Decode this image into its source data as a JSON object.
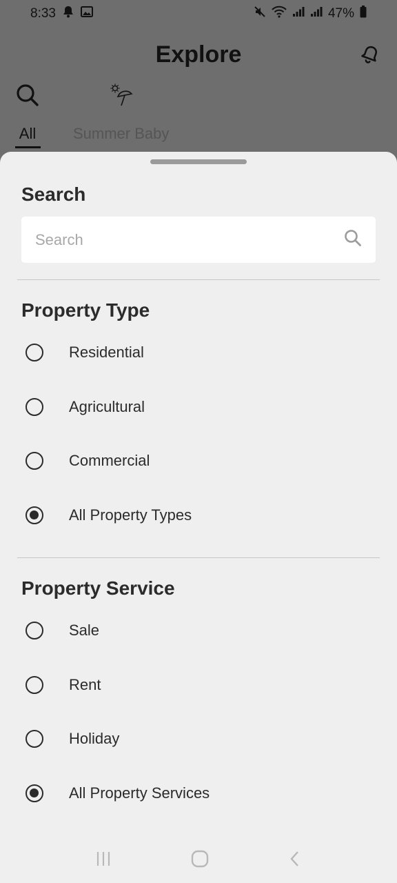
{
  "status_bar": {
    "time": "8:33",
    "battery": "47%",
    "left_icons": [
      "bell-icon",
      "image-icon"
    ],
    "right_icons": [
      "mute-icon",
      "wifi-icon",
      "signal-icon",
      "signal-icon",
      "battery-icon"
    ]
  },
  "header": {
    "title": "Explore",
    "right_icon": "bell-icon"
  },
  "categories": [
    {
      "label": "All",
      "icon": "search-icon",
      "active": true
    },
    {
      "label": "Summer Baby",
      "icon": "beach-umbrella-icon",
      "active": false
    }
  ],
  "search_section": {
    "title": "Search",
    "placeholder": "Search",
    "value": ""
  },
  "property_type": {
    "title": "Property Type",
    "options": [
      {
        "label": "Residential",
        "checked": false
      },
      {
        "label": "Agricultural",
        "checked": false
      },
      {
        "label": "Commercial",
        "checked": false
      },
      {
        "label": "All Property Types",
        "checked": true
      }
    ]
  },
  "property_service": {
    "title": "Property Service",
    "options": [
      {
        "label": "Sale",
        "checked": false
      },
      {
        "label": "Rent",
        "checked": false
      },
      {
        "label": "Holiday",
        "checked": false
      },
      {
        "label": "All Property Services",
        "checked": true
      }
    ]
  },
  "nav_bar": {
    "buttons": [
      "recent-apps-icon",
      "home-icon",
      "back-icon"
    ]
  },
  "colors": {
    "sheet_background": "#efefef",
    "dim_overlay": "#6e6e6e",
    "text_primary": "#2b2b2b",
    "placeholder": "#a8a8a8"
  }
}
